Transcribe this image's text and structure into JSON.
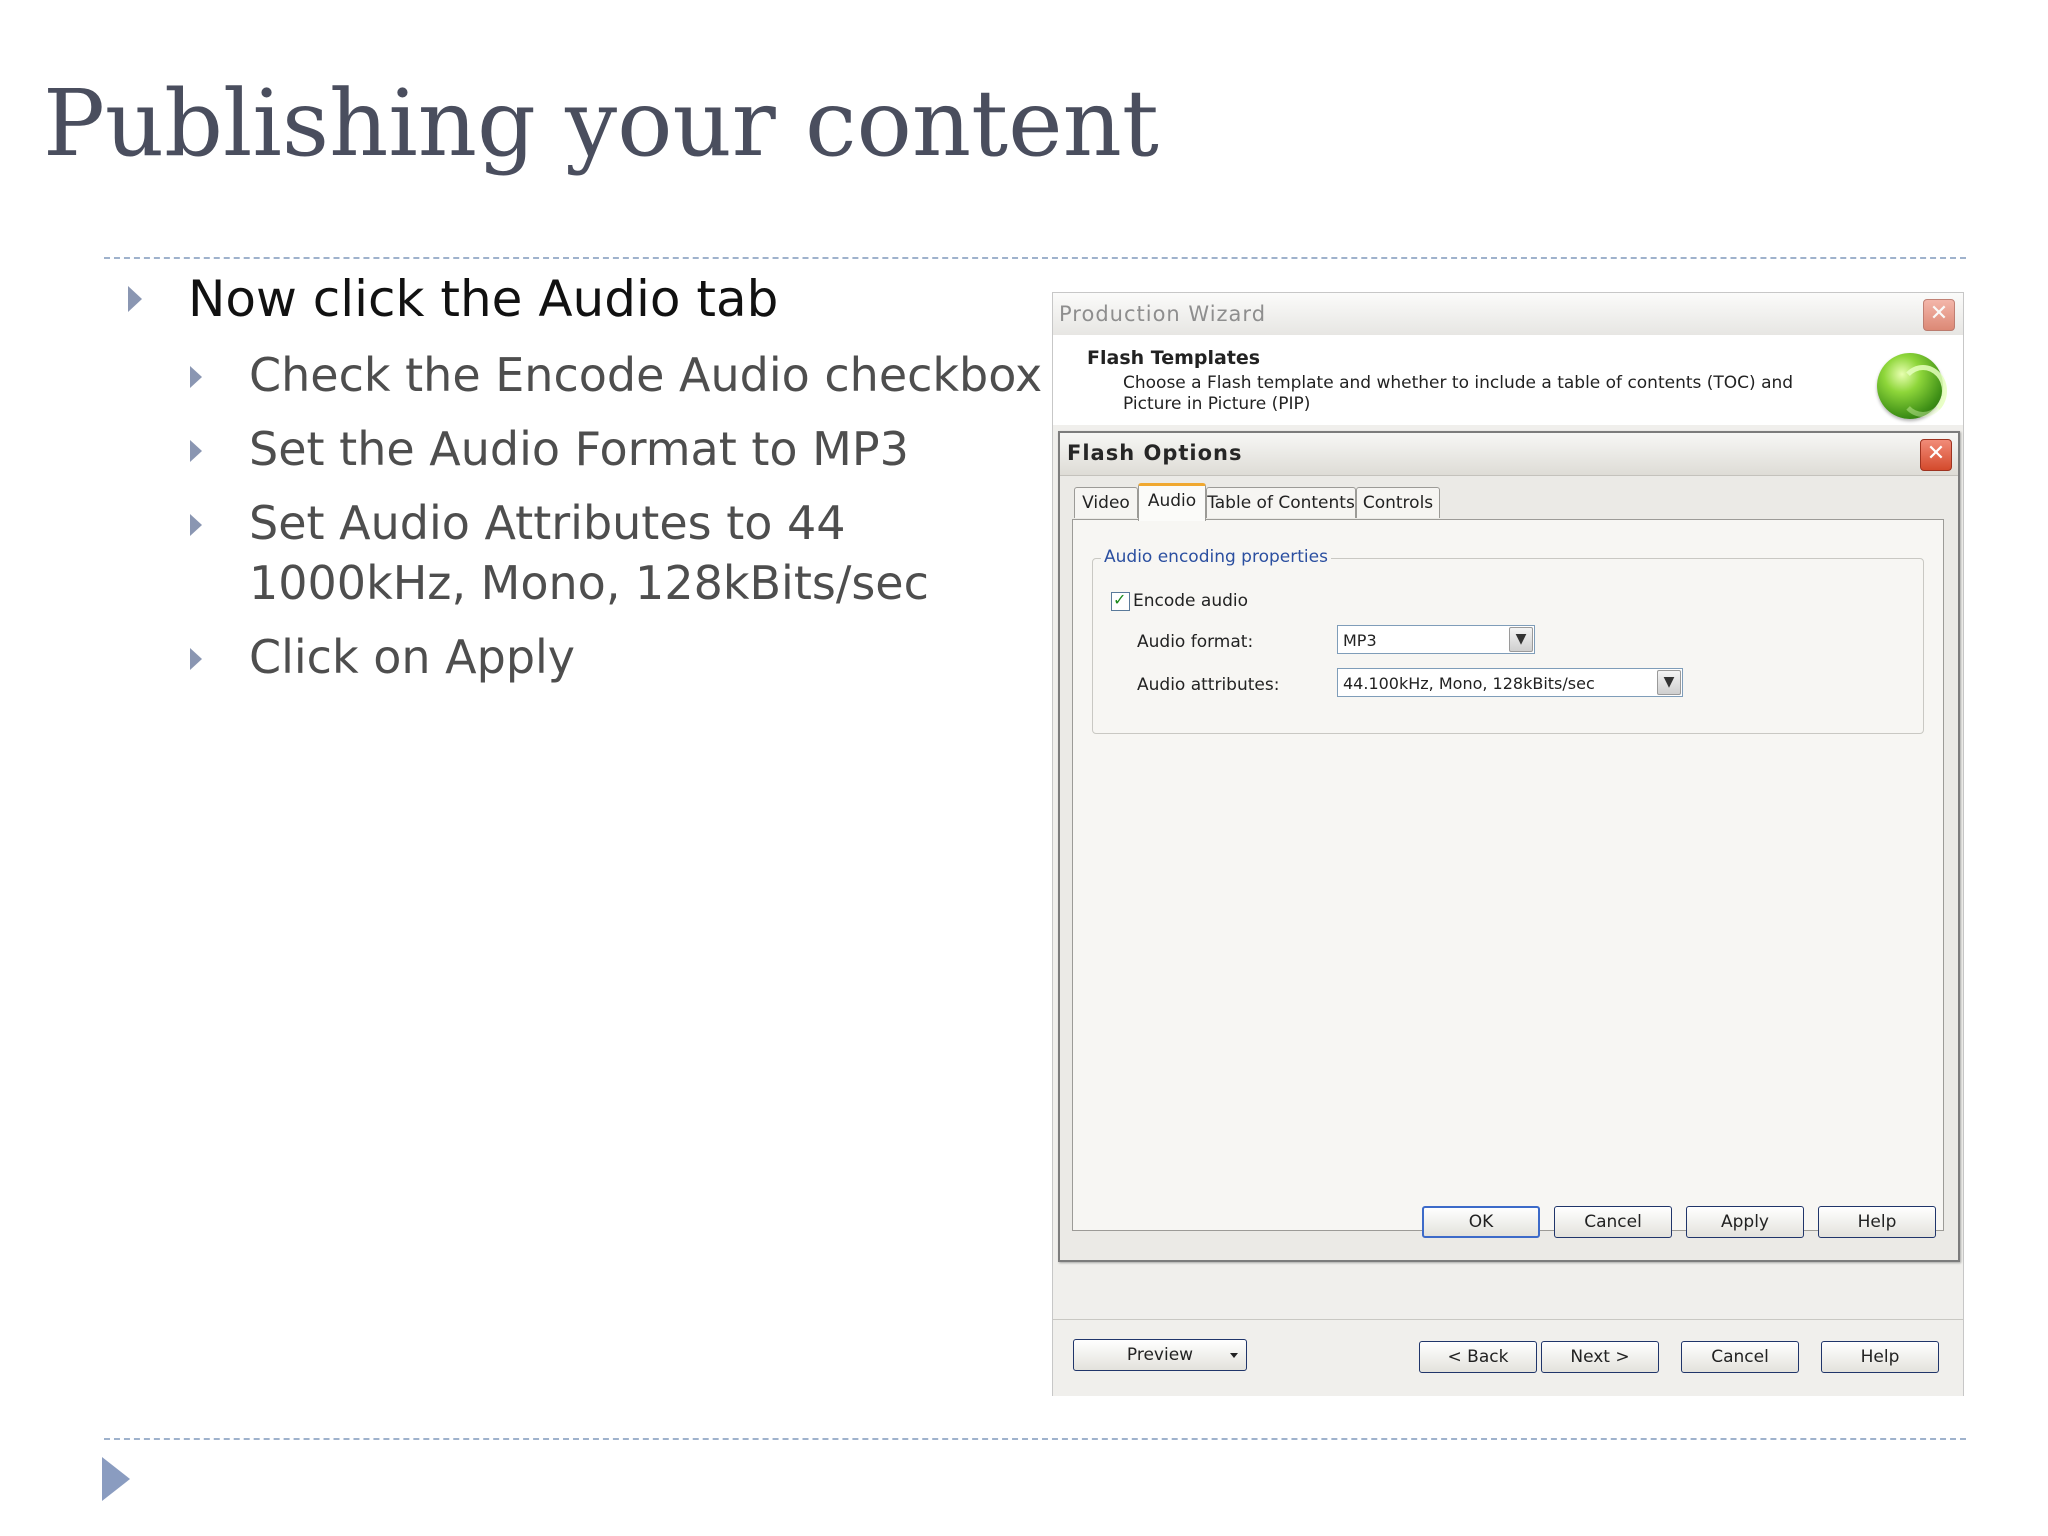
{
  "slide": {
    "title": "Publishing your content",
    "bullets": [
      "Now click the Audio tab",
      "Check the Encode Audio checkbox",
      "Set the Audio Format to MP3",
      "Set Audio Attributes to 44",
      "1000kHz, Mono, 128kBits/sec",
      "Click on Apply"
    ]
  },
  "wizard": {
    "title": "Production Wizard",
    "close_label": "✕",
    "header_title": "Flash Templates",
    "header_desc": "Choose a Flash template and whether to include a table of contents (TOC) and Picture in Picture (PIP)",
    "footer": {
      "preview_label": "Preview",
      "back_label": "< Back",
      "next_label": "Next >",
      "cancel_label": "Cancel",
      "help_label": "Help"
    }
  },
  "flash_options": {
    "title": "Flash Options",
    "close_label": "✕",
    "tabs": [
      "Video",
      "Audio",
      "Table of Contents",
      "Controls"
    ],
    "active_tab": "Audio",
    "group_label": "Audio encoding properties",
    "encode_audio_label": "Encode audio",
    "encode_audio_checked": true,
    "audio_format_label": "Audio format:",
    "audio_format_value": "MP3",
    "audio_attributes_label": "Audio attributes:",
    "audio_attributes_value": "44.100kHz, Mono, 128kBits/sec",
    "buttons": {
      "ok": "OK",
      "cancel": "Cancel",
      "apply": "Apply",
      "help": "Help"
    }
  },
  "icons": {
    "checkmark": "✓",
    "dropdown": "▼"
  },
  "colors": {
    "title_text": "#4a4e5e",
    "bullet_arrow": "#8a96b2",
    "active_tab_accent": "#f0a830",
    "close_button": "#d44a2c"
  }
}
